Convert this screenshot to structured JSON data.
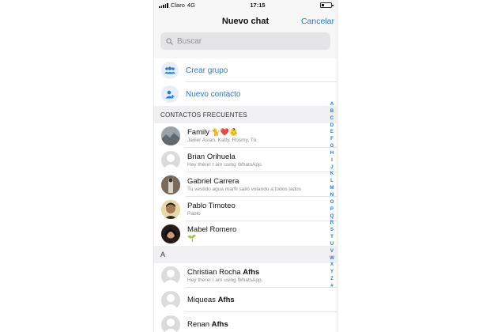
{
  "status": {
    "carrier": "Claro",
    "network": "4G",
    "time": "17:15"
  },
  "nav": {
    "title": "Nuevo chat",
    "cancel": "Cancelar"
  },
  "search": {
    "placeholder": "Buscar"
  },
  "actions": [
    {
      "label": "Crear grupo",
      "icon": "group-icon"
    },
    {
      "label": "Nuevo contacto",
      "icon": "add-contact-icon"
    }
  ],
  "sections": {
    "frequent": "CONTACTOS FRECUENTES",
    "a": "A"
  },
  "frequent_contacts": [
    {
      "name": "Family",
      "emoji": "🐈❤️👶",
      "subtitle": "Javier Asian, Katty, Rosmy, Tú"
    },
    {
      "name": "Brian Orihuela",
      "subtitle": "Hey there! I am using WhatsApp."
    },
    {
      "name": "Gabriel Carrera",
      "subtitle": "Tu vestido agua marfil salió volando a todos lados"
    },
    {
      "name": "Pablo Timoteo",
      "subtitle": "Pablo"
    },
    {
      "name": "Mabel Romero",
      "subtitle": "🌱"
    }
  ],
  "a_contacts": [
    {
      "name_first": "Christian Rocha",
      "name_bold": "Afhs",
      "subtitle": "Hey there! I am using WhatsApp."
    },
    {
      "name_first": "Miqueas",
      "name_bold": "Afhs",
      "subtitle": ""
    },
    {
      "name_first": "Renan",
      "name_bold": "Afhs",
      "subtitle": ""
    }
  ],
  "index_letters": [
    "A",
    "B",
    "C",
    "D",
    "E",
    "F",
    "G",
    "H",
    "I",
    "J",
    "K",
    "L",
    "M",
    "N",
    "O",
    "P",
    "Q",
    "R",
    "S",
    "T",
    "U",
    "V",
    "W",
    "X",
    "Y",
    "Z",
    "#"
  ],
  "colors": {
    "accent": "#1f7ae0",
    "section_bg": "#f0f0f2"
  }
}
